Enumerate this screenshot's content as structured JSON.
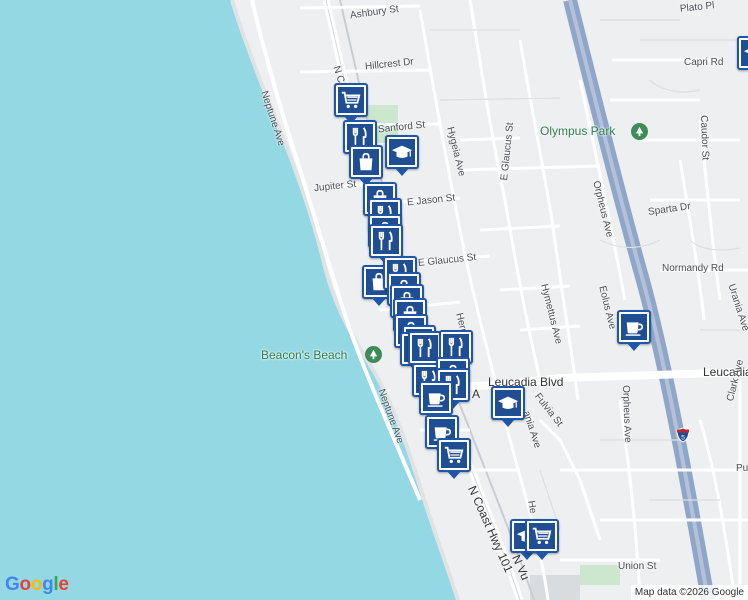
{
  "map": {
    "attribution": "Map data ©2026 Google",
    "logo": "Google",
    "colors": {
      "water": "#94d8e4",
      "land": "#eeeff1",
      "road": "#ffffff",
      "freeway": "#8fa6c8",
      "park": "#cde7cf",
      "pin_border": "#1f57a6"
    }
  },
  "streets": [
    {
      "id": "ashbury",
      "text": "Ashbury St"
    },
    {
      "id": "plato",
      "text": "Plato Pl"
    },
    {
      "id": "hillcrest",
      "text": "Hillcrest Dr"
    },
    {
      "id": "capri",
      "text": "Capri Rd"
    },
    {
      "id": "neptune-n",
      "text": "Neptune Ave"
    },
    {
      "id": "nc",
      "text": "N C"
    },
    {
      "id": "sanford",
      "text": "Sanford St"
    },
    {
      "id": "hygeia",
      "text": "Hygeia Ave"
    },
    {
      "id": "caudor",
      "text": "Caudor St"
    },
    {
      "id": "jupiter",
      "text": "Jupiter St"
    },
    {
      "id": "jason",
      "text": "E Jason St"
    },
    {
      "id": "glaucus-e",
      "text": "E Glaucus St"
    },
    {
      "id": "glaucus",
      "text": "E Glaucus St"
    },
    {
      "id": "orpheus-n",
      "text": "Orpheus Ave"
    },
    {
      "id": "sparta",
      "text": "Sparta Dr"
    },
    {
      "id": "normandy",
      "text": "Normandy Rd"
    },
    {
      "id": "hymettus",
      "text": "Hymettus Ave"
    },
    {
      "id": "eolus",
      "text": "Eolus Ave"
    },
    {
      "id": "urania",
      "text": "Urania Ave"
    },
    {
      "id": "hermes",
      "text": "Herm"
    },
    {
      "id": "leucadia",
      "text": "Leucadia Blvd"
    },
    {
      "id": "leucadia-e",
      "text": "Leucadia"
    },
    {
      "id": "fulvia",
      "text": "Fulvia St"
    },
    {
      "id": "ania",
      "text": "ania Ave"
    },
    {
      "id": "neptune-s",
      "text": "Neptune Ave"
    },
    {
      "id": "orpheus-s",
      "text": "Orpheus Ave"
    },
    {
      "id": "clark",
      "text": "Clark Ave"
    },
    {
      "id": "pu",
      "text": "Pu"
    },
    {
      "id": "coast",
      "text": "N Coast Hwy 101"
    },
    {
      "id": "nvu",
      "text": "N Vu"
    },
    {
      "id": "he",
      "text": "He"
    },
    {
      "id": "union",
      "text": "Union St"
    },
    {
      "id": "a",
      "text": "A"
    }
  ],
  "parks": [
    {
      "id": "olympus",
      "text": "Olympus Park"
    },
    {
      "id": "beacons",
      "text": "Beacon's Beach"
    }
  ],
  "highway_shield": "5",
  "pins": [
    {
      "id": "p1",
      "icon": "cart"
    },
    {
      "id": "p2",
      "icon": "graduation-cap"
    },
    {
      "id": "p3",
      "icon": "fork-knife"
    },
    {
      "id": "p4",
      "icon": "graduation-cap"
    },
    {
      "id": "p5",
      "icon": "shopping-bag"
    },
    {
      "id": "p6",
      "icon": "shopping-bag"
    },
    {
      "id": "p7",
      "icon": "fork-knife"
    },
    {
      "id": "p8",
      "icon": "shopping-bag"
    },
    {
      "id": "p9",
      "icon": "fork-knife"
    },
    {
      "id": "p10",
      "icon": "shopping-bag"
    },
    {
      "id": "p11",
      "icon": "fork-knife"
    },
    {
      "id": "p12",
      "icon": "shopping-bag"
    },
    {
      "id": "p13",
      "icon": "shopping-bag"
    },
    {
      "id": "p14",
      "icon": "shopping-bag"
    },
    {
      "id": "p15",
      "icon": "shopping-bag"
    },
    {
      "id": "p16",
      "icon": "fork-knife"
    },
    {
      "id": "p17",
      "icon": "fork-knife"
    },
    {
      "id": "p18",
      "icon": "fork-knife"
    },
    {
      "id": "p19",
      "icon": "fork-knife"
    },
    {
      "id": "p20",
      "icon": "fork-knife"
    },
    {
      "id": "p21",
      "icon": "shopping-bag"
    },
    {
      "id": "p22",
      "icon": "fork-knife"
    },
    {
      "id": "p23",
      "icon": "coffee-cup"
    },
    {
      "id": "p24",
      "icon": "graduation-cap"
    },
    {
      "id": "p25",
      "icon": "coffee-cup"
    },
    {
      "id": "p26",
      "icon": "cart"
    },
    {
      "id": "p27",
      "icon": "coffee-cup"
    },
    {
      "id": "p28",
      "icon": "graduation-cap"
    },
    {
      "id": "p29",
      "icon": "cart"
    }
  ]
}
